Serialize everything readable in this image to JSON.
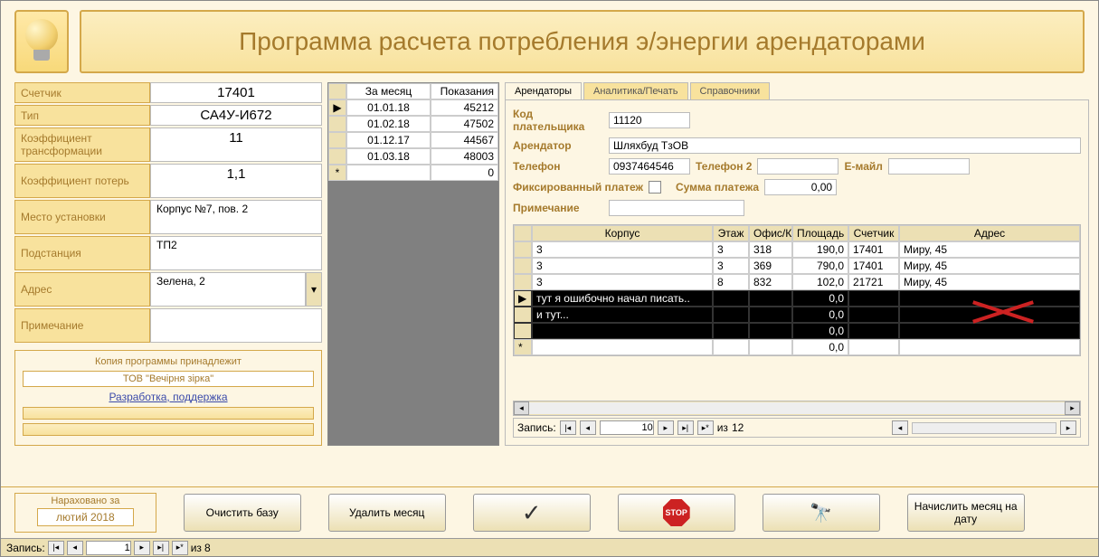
{
  "app": {
    "title": "Программа расчета потребления э/энергии арендаторами"
  },
  "meter_panel": {
    "labels": {
      "meter": "Счетчик",
      "type": "Тип",
      "coef_trans": "Коэффициент трансформации",
      "coef_loss": "Коэффициент потерь",
      "location": "Место установки",
      "substation": "Подстанция",
      "address": "Адрес",
      "note": "Примечание"
    },
    "values": {
      "meter": "17401",
      "type": "СА4У-И672",
      "coef_trans": "11",
      "coef_loss": "1,1",
      "location": "Корпус №7, пов. 2",
      "substation": "ТП2",
      "address": "Зелена, 2",
      "note": ""
    }
  },
  "copy_box": {
    "legend": "Копия программы принадлежит",
    "owner": "ТОВ \"Вечірня зірка\"",
    "link": "Разработка, поддержка"
  },
  "readings": {
    "headers": {
      "month": "За месяц",
      "reading": "Показания"
    },
    "rows": [
      {
        "date": "01.01.18",
        "value": "45212"
      },
      {
        "date": "01.02.18",
        "value": "47502"
      },
      {
        "date": "01.12.17",
        "value": "44567"
      },
      {
        "date": "01.03.18",
        "value": "48003"
      }
    ],
    "new_value": "0"
  },
  "tabs": {
    "tenants": "Арендаторы",
    "analytics": "Аналитика/Печать",
    "refs": "Справочники"
  },
  "tenant_form": {
    "labels": {
      "payer": "Код плательщика",
      "tenant": "Арендатор",
      "phone": "Телефон",
      "phone2": "Телефон 2",
      "email": "Е-майл",
      "fixed": "Фиксированный платеж",
      "sum": "Сумма платежа",
      "note": "Примечание"
    },
    "values": {
      "payer": "11120",
      "tenant": "Шляхбуд ТзОВ",
      "phone": "0937464546",
      "phone2": "",
      "email": "",
      "sum": "0,00",
      "note": ""
    }
  },
  "tenant_table": {
    "headers": {
      "korpus": "Корпус",
      "floor": "Этаж",
      "office": "Офис/К",
      "area": "Площадь",
      "meter": "Счетчик",
      "addr": "Адрес"
    },
    "rows": [
      {
        "korpus": "3",
        "floor": "3",
        "office": "318",
        "area": "190,0",
        "meter": "17401",
        "addr": "Миру, 45"
      },
      {
        "korpus": "3",
        "floor": "3",
        "office": "369",
        "area": "790,0",
        "meter": "17401",
        "addr": "Миру, 45"
      },
      {
        "korpus": "3",
        "floor": "8",
        "office": "832",
        "area": "102,0",
        "meter": "21721",
        "addr": "Миру, 45"
      }
    ],
    "error_rows": [
      {
        "korpus": "тут я ошибочно начал писать..",
        "area": "0,0"
      },
      {
        "korpus": "и тут...",
        "area": "0,0"
      },
      {
        "korpus": "",
        "area": "0,0"
      }
    ],
    "blank_area": "0,0"
  },
  "tenant_nav": {
    "label": "Запись:",
    "current": "10",
    "of_label": "из",
    "total": "12"
  },
  "bottom": {
    "charged_legend": "Нараховано за",
    "charged_value": "лютий 2018",
    "clear": "Очистить базу",
    "del_month": "Удалить месяц",
    "run_month": "Начислить месяц на дату"
  },
  "status": {
    "label": "Запись:",
    "current": "1",
    "of_label": "из",
    "total": "8"
  }
}
